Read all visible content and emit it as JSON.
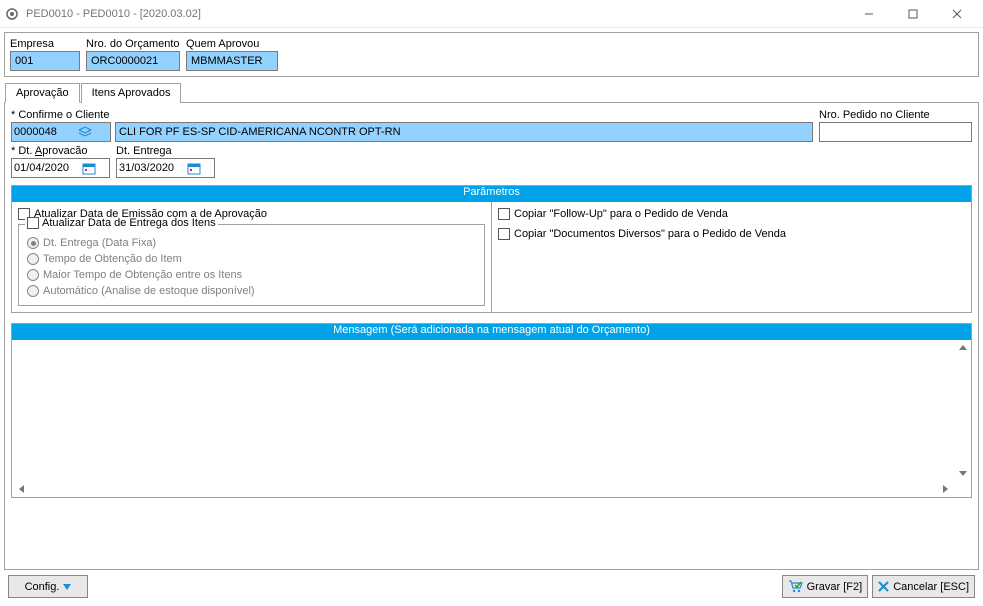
{
  "titlebar": "PED0010 - PED0010 - [2020.03.02]",
  "hdr": {
    "empresa_label": "Empresa",
    "empresa": "001",
    "nro_label": "Nro. do Orçamento",
    "nro": "ORC0000021",
    "quem_label": "Quem Aprovou",
    "quem": "MBMMASTER"
  },
  "tabs": {
    "aprovacao": "Aprovação",
    "itens": "Itens Aprovados"
  },
  "form": {
    "cliente_label": "* Confirme o Cliente",
    "cliente_code": "0000048",
    "cliente_desc": "CLI FOR PF ES-SP CID-AMERICANA NCONTR OPT-RN",
    "nro_pedido_label": "Nro. Pedido no Cliente",
    "nro_pedido": "",
    "dtap_label": "* Dt. Aprovacão",
    "dtap": "01/04/2020",
    "dtent_label": "Dt. Entrega",
    "dtent": "31/03/2020"
  },
  "params": {
    "title": "Parâmetros",
    "chk1": "Atualizar Data de Emissão com a de Aprovação",
    "chk2": "Copiar \"Follow-Up\" para o Pedido de Venda",
    "chk3": "Copiar \"Documentos Diversos\" para o Pedido de Venda",
    "grp_legend": "Atualizar Data de Entrega dos Itens",
    "r1": "Dt. Entrega (Data Fixa)",
    "r2": "Tempo de Obtenção do Item",
    "r3": "Maior Tempo de Obtenção entre os Itens",
    "r4": "Automático (Analise de estoque disponível)"
  },
  "msg_title": "Mensagem (Será adicionada na mensagem atual do Orçamento)",
  "footer": {
    "config": "Config.",
    "gravar": "Gravar [F2]",
    "cancelar": "Cancelar [ESC]"
  }
}
